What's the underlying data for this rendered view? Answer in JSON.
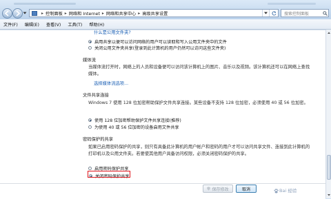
{
  "address_bar": {
    "crumbs": [
      "控制面板",
      "网络和 Internet",
      "网络和共享中心",
      "高级共享设置"
    ],
    "search_placeholder": "搜索控制面板"
  },
  "menu": [
    "文件(F)",
    "编辑(E)",
    "查看(V)",
    "工具(T)",
    "帮助(H)"
  ],
  "top_link": "什么是公用文件夹?",
  "public_folder": {
    "options": [
      {
        "label": "启用共享以便可以访问网络的用户可以读取和写入公用文件夹中的文件",
        "selected": true
      },
      {
        "label": "关闭公用文件夹共享(登录到此计算机的用户仍然可以访问这些文件夹)",
        "selected": false
      }
    ]
  },
  "media_streaming": {
    "heading": "媒体流",
    "text": "当媒体流打开时，网络上的人员和设备便可以访问该计算机上的图片、音乐以及视频。该计算机还可以在网络上查找媒体。",
    "link": "选择媒体流选项..."
  },
  "file_sharing_connections": {
    "heading": "文件共享连接",
    "text": "Windows 7 使用 128 位加密帮助保护文件共享连接。某些设备不支持 128 位加密，必须使用 40 或 56 位加密。",
    "options": [
      {
        "label": "使用 128 位加密帮助保护文件共享连接(推荐)",
        "selected": true
      },
      {
        "label": "为使用 40 或 56 位加密的设备启用文件共享",
        "selected": false
      }
    ]
  },
  "password_protected_sharing": {
    "heading": "密码保护的共享",
    "text": "如果已启用密码保护的共享，则只有具备此计算机的用户帐户和密码的用户才可以访问共享文件、连接到此计算机的打印机以及公用文件夹。若要使其他用户具备访问权限，必须关闭密码保护的共享。",
    "options": [
      {
        "label": "启用密码保护共享",
        "selected": false
      },
      {
        "label": "关闭密码保护共享",
        "selected": true
      }
    ]
  },
  "buttons": {
    "save": "保存修改",
    "cancel": "取消"
  },
  "watermark": "Bai 经验",
  "colors": {
    "link": "#1a5fb4",
    "highlight_box": "#e0141b"
  }
}
